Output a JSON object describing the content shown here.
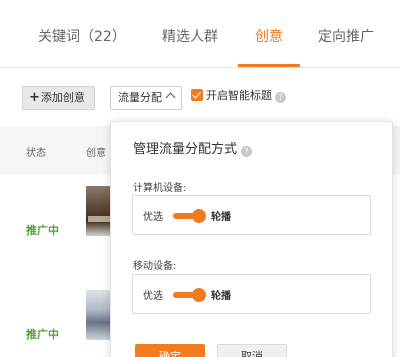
{
  "tabs": [
    {
      "label": "关键词（22）",
      "active": false
    },
    {
      "label": "精选人群",
      "active": false
    },
    {
      "label": "创意",
      "active": true
    },
    {
      "label": "定向推广",
      "active": false
    }
  ],
  "toolbar": {
    "add_label": "添加创意",
    "traffic_label": "流量分配",
    "smart_title_label": "开启智能标题",
    "smart_title_checked": true
  },
  "table": {
    "headers": [
      "状态",
      "创意"
    ],
    "rows": [
      {
        "status": "推广中"
      },
      {
        "status": "推广中"
      }
    ]
  },
  "popup": {
    "title": "管理流量分配方式",
    "sections": [
      {
        "label": "计算机设备:",
        "left": "优选",
        "right": "轮播",
        "right_selected": true
      },
      {
        "label": "移动设备:",
        "left": "优选",
        "right": "轮播",
        "right_selected": true
      }
    ],
    "ok_label": "确定",
    "cancel_label": "取消"
  },
  "colors": {
    "accent": "#f47a1f",
    "status_green": "#52a33a"
  }
}
